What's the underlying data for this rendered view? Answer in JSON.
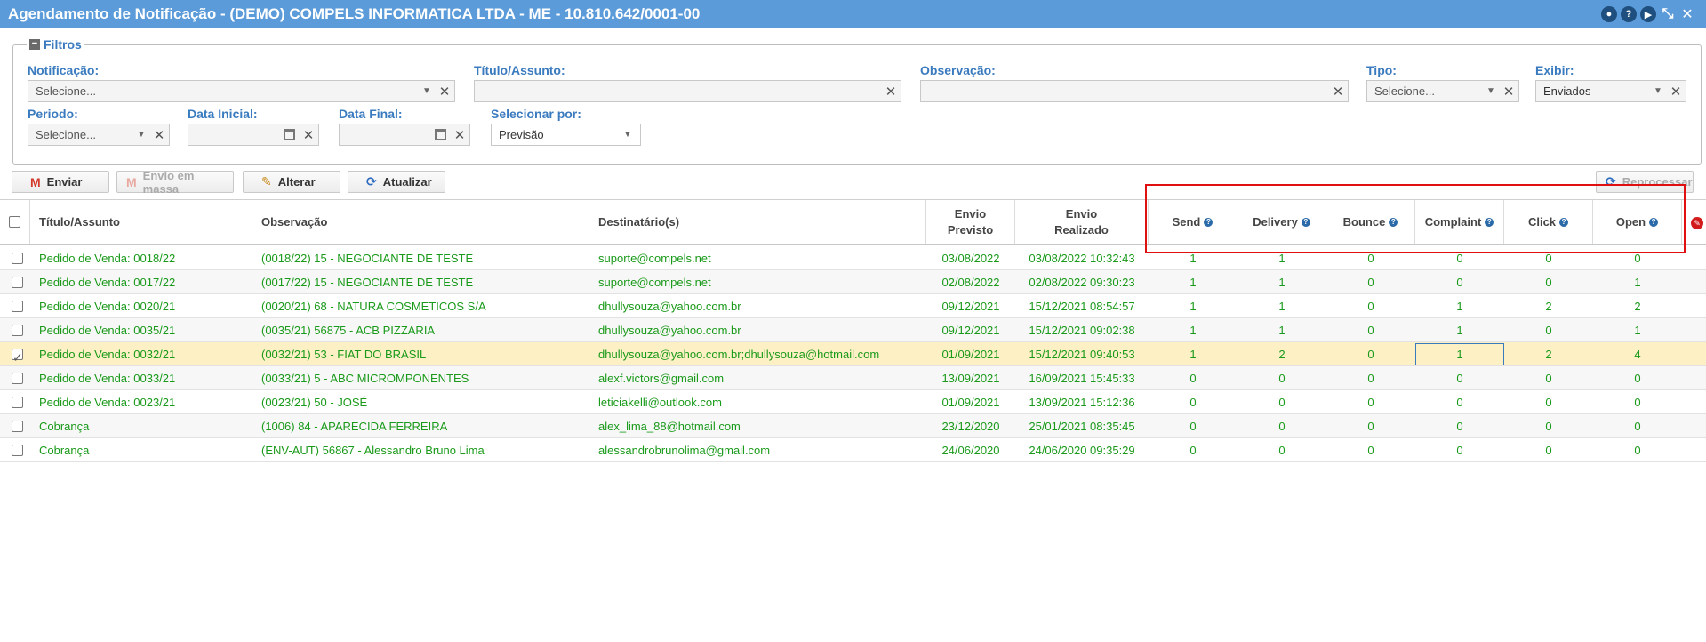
{
  "window": {
    "title": "Agendamento de Notificação - (DEMO) COMPELS INFORMATICA LTDA - ME - 10.810.642/0001-00"
  },
  "filters": {
    "legend": "Filtros",
    "notificacao": {
      "label": "Notificação:",
      "value": "Selecione..."
    },
    "titulo": {
      "label": "Título/Assunto:",
      "value": ""
    },
    "observacao": {
      "label": "Observação:",
      "value": ""
    },
    "tipo": {
      "label": "Tipo:",
      "value": "Selecione..."
    },
    "exibir": {
      "label": "Exibir:",
      "value": "Enviados"
    },
    "periodo": {
      "label": "Periodo:",
      "value": "Selecione..."
    },
    "data_inicial": {
      "label": "Data Inicial:",
      "value": ""
    },
    "data_final": {
      "label": "Data Final:",
      "value": ""
    },
    "selecionar_por": {
      "label": "Selecionar por:",
      "value": "Previsão"
    }
  },
  "toolbar": {
    "enviar": "Enviar",
    "envio_massa": "Envio em massa",
    "alterar": "Alterar",
    "atualizar": "Atualizar",
    "reprocessar": "Reprocessar"
  },
  "columns": {
    "titulo": "Título/Assunto",
    "observacao": "Observação",
    "destinatarios": "Destinatário(s)",
    "envio_previsto": [
      "Envio",
      "Previsto"
    ],
    "envio_realizado": [
      "Envio",
      "Realizado"
    ],
    "send": "Send",
    "delivery": "Delivery",
    "bounce": "Bounce",
    "complaint": "Complaint",
    "click": "Click",
    "open": "Open"
  },
  "rows": [
    {
      "checked": false,
      "titulo": "Pedido de Venda: 0018/22",
      "obs": "(0018/22) 15 - NEGOCIANTE DE TESTE",
      "dest": "suporte@compels.net",
      "prev": "03/08/2022",
      "real": "03/08/2022 10:32:43",
      "send": "1",
      "delivery": "1",
      "bounce": "0",
      "complaint": "0",
      "click": "0",
      "open": "0"
    },
    {
      "checked": false,
      "titulo": "Pedido de Venda: 0017/22",
      "obs": "(0017/22) 15 - NEGOCIANTE DE TESTE",
      "dest": "suporte@compels.net",
      "prev": "02/08/2022",
      "real": "02/08/2022 09:30:23",
      "send": "1",
      "delivery": "1",
      "bounce": "0",
      "complaint": "0",
      "click": "0",
      "open": "1"
    },
    {
      "checked": false,
      "titulo": "Pedido de Venda: 0020/21",
      "obs": "(0020/21) 68 - NATURA COSMETICOS S/A",
      "dest": "dhullysouza@yahoo.com.br",
      "prev": "09/12/2021",
      "real": "15/12/2021 08:54:57",
      "send": "1",
      "delivery": "1",
      "bounce": "0",
      "complaint": "1",
      "click": "2",
      "open": "2"
    },
    {
      "checked": false,
      "titulo": "Pedido de Venda: 0035/21",
      "obs": "(0035/21) 56875 - ACB PIZZARIA",
      "dest": "dhullysouza@yahoo.com.br",
      "prev": "09/12/2021",
      "real": "15/12/2021 09:02:38",
      "send": "1",
      "delivery": "1",
      "bounce": "0",
      "complaint": "1",
      "click": "0",
      "open": "1"
    },
    {
      "checked": true,
      "titulo": "Pedido de Venda: 0032/21",
      "obs": "(0032/21) 53 - FIAT DO BRASIL",
      "dest": "dhullysouza@yahoo.com.br;dhullysouza@hotmail.com",
      "prev": "01/09/2021",
      "real": "15/12/2021 09:40:53",
      "send": "1",
      "delivery": "2",
      "bounce": "0",
      "complaint": "1",
      "click": "2",
      "open": "4"
    },
    {
      "checked": false,
      "titulo": "Pedido de Venda: 0033/21",
      "obs": "(0033/21) 5 - ABC MICROMPONENTES",
      "dest": "alexf.victors@gmail.com",
      "prev": "13/09/2021",
      "real": "16/09/2021 15:45:33",
      "send": "0",
      "delivery": "0",
      "bounce": "0",
      "complaint": "0",
      "click": "0",
      "open": "0"
    },
    {
      "checked": false,
      "titulo": "Pedido de Venda: 0023/21",
      "obs": "(0023/21) 50 - JOSÉ",
      "dest": "leticiakelli@outlook.com",
      "prev": "01/09/2021",
      "real": "13/09/2021 15:12:36",
      "send": "0",
      "delivery": "0",
      "bounce": "0",
      "complaint": "0",
      "click": "0",
      "open": "0"
    },
    {
      "checked": false,
      "titulo": "Cobrança",
      "obs": "(1006) 84 - APARECIDA FERREIRA",
      "dest": "alex_lima_88@hotmail.com",
      "prev": "23/12/2020",
      "real": "25/01/2021 08:35:45",
      "send": "0",
      "delivery": "0",
      "bounce": "0",
      "complaint": "0",
      "click": "0",
      "open": "0"
    },
    {
      "checked": false,
      "titulo": "Cobrança",
      "obs": "(ENV-AUT) 56867 - Alessandro Bruno Lima",
      "dest": "alessandrobrunolima@gmail.com",
      "prev": "24/06/2020",
      "real": "24/06/2020 09:35:29",
      "send": "0",
      "delivery": "0",
      "bounce": "0",
      "complaint": "0",
      "click": "0",
      "open": "0"
    }
  ]
}
